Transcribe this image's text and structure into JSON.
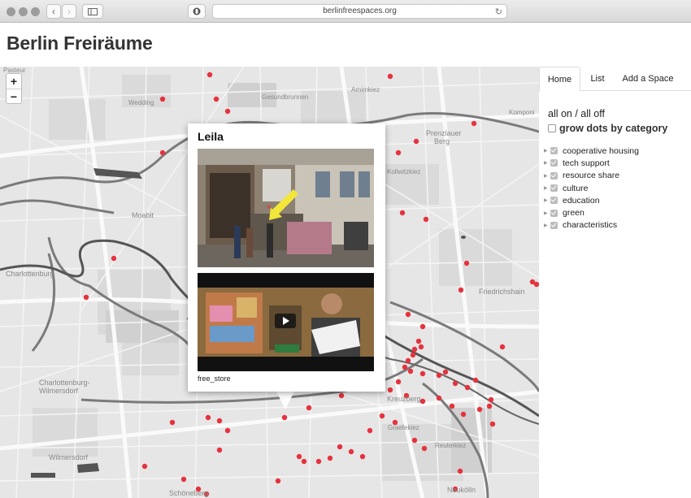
{
  "browser": {
    "url": "berlinfreespaces.org"
  },
  "header": {
    "title": "Berlin Freiräume"
  },
  "map": {
    "zoom_in": "+",
    "zoom_out": "−",
    "places": {
      "pasteur": "Pasteur",
      "wedding": "Wedding",
      "gesundbrunnen": "Gesundbrunnen",
      "arnimkiez": "Arnimkiez",
      "komponist": "Komponi",
      "prenzlauer": "Prenzlauer",
      "berg": "Berg",
      "kollwitz": "Kollwitzkiez",
      "moabit": "Moabit",
      "charlottenburg": "Charlottenburg",
      "friedrichshain": "Friedrichshain",
      "charlottenburg_wilmersdorf": "Charlottenburg-",
      "wilmersdorf_line2": "Wilmersdorf",
      "kreuzberg": "Kreuzberg",
      "graefekiez": "Graefekiez",
      "reuterkiez": "Reuterkiez",
      "wilmersdorf": "Wilmersdorf",
      "schoeneberg": "Schöneberg",
      "neukolln": "Neukölln"
    },
    "dot_color": "#e5323e"
  },
  "popup": {
    "title": "Leila",
    "category": "free_store"
  },
  "sidebar": {
    "tabs": [
      {
        "label": "Home"
      },
      {
        "label": "List"
      },
      {
        "label": "Add a Space"
      }
    ],
    "all_on_off": "all on / all off",
    "grow_label": "grow dots by category",
    "categories": [
      {
        "label": "cooperative housing"
      },
      {
        "label": "tech support"
      },
      {
        "label": "resource share"
      },
      {
        "label": "culture"
      },
      {
        "label": "education"
      },
      {
        "label": "green"
      },
      {
        "label": "characteristics"
      }
    ]
  }
}
